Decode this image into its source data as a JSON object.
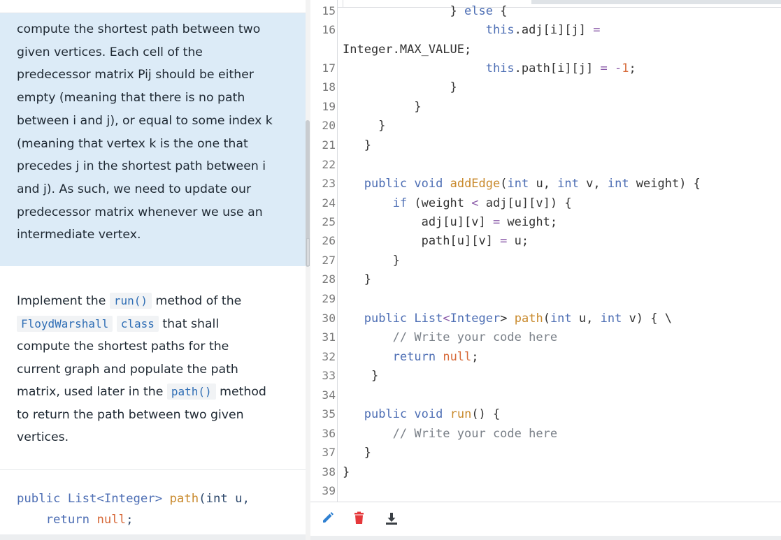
{
  "left": {
    "paragraph1_lines": [
      "compute the shortest path between two",
      "given vertices. Each cell of the",
      "predecessor matrix Pij should be either",
      "empty (meaning that there is no path",
      "between i and j), or equal to some index k",
      "(meaning that vertex k is the one that",
      "precedes j in the shortest path between i",
      "and j). As such, we need to update our",
      "predecessor matrix whenever we use an",
      "intermediate vertex."
    ],
    "paragraph2": {
      "l1_pre": "Implement the ",
      "l1_code": "run()",
      "l1_post": " method of the",
      "l2_code1": "FloydWarshall",
      "l2_code2": "class",
      "l2_post": " that shall",
      "l3": "compute the shortest paths for the",
      "l4": "current graph and populate the path",
      "l5_pre": "matrix, used later in the ",
      "l5_code": "path()",
      "l5_post": " method",
      "l6": "to return the path between two given",
      "l7": "vertices."
    },
    "snippet": {
      "line1_kw1": "public ",
      "line1_type": "List<Integer> ",
      "line1_fn": "path",
      "line1_rest": "(int u, ",
      "line2_kw": "return ",
      "line2_null": "null",
      "line2_semi": ";"
    }
  },
  "editor": {
    "line_numbers": [
      "15",
      "16",
      "",
      "17",
      "18",
      "19",
      "20",
      "21",
      "22",
      "23",
      "24",
      "25",
      "26",
      "27",
      "28",
      "29",
      "30",
      "31",
      "32",
      "33",
      "34",
      "35",
      "36",
      "37",
      "38",
      "39"
    ],
    "code_lines": [
      "               } else {",
      "                    this.adj[i][j] =",
      "Integer.MAX_VALUE;",
      "                    this.path[i][j] = -1;",
      "               }",
      "          }",
      "     }",
      "   }",
      "",
      "   public void addEdge(int u, int v, int weight) {",
      "       if (weight < adj[u][v]) {",
      "           adj[u][v] = weight;",
      "           path[u][v] = u;",
      "       }",
      "   }",
      "",
      "   public List<Integer> path(int u, int v) { \\",
      "       // Write your code here",
      "       return null;",
      "    }",
      "",
      "   public void run() {",
      "       // Write your code here",
      "   }",
      "}",
      ""
    ]
  },
  "toolbar": {
    "icons": [
      "pencil-icon",
      "trash-icon",
      "download-icon"
    ],
    "colors": {
      "edit": "#2f80d1",
      "delete": "#e5383b",
      "download": "#3a3f45"
    }
  }
}
